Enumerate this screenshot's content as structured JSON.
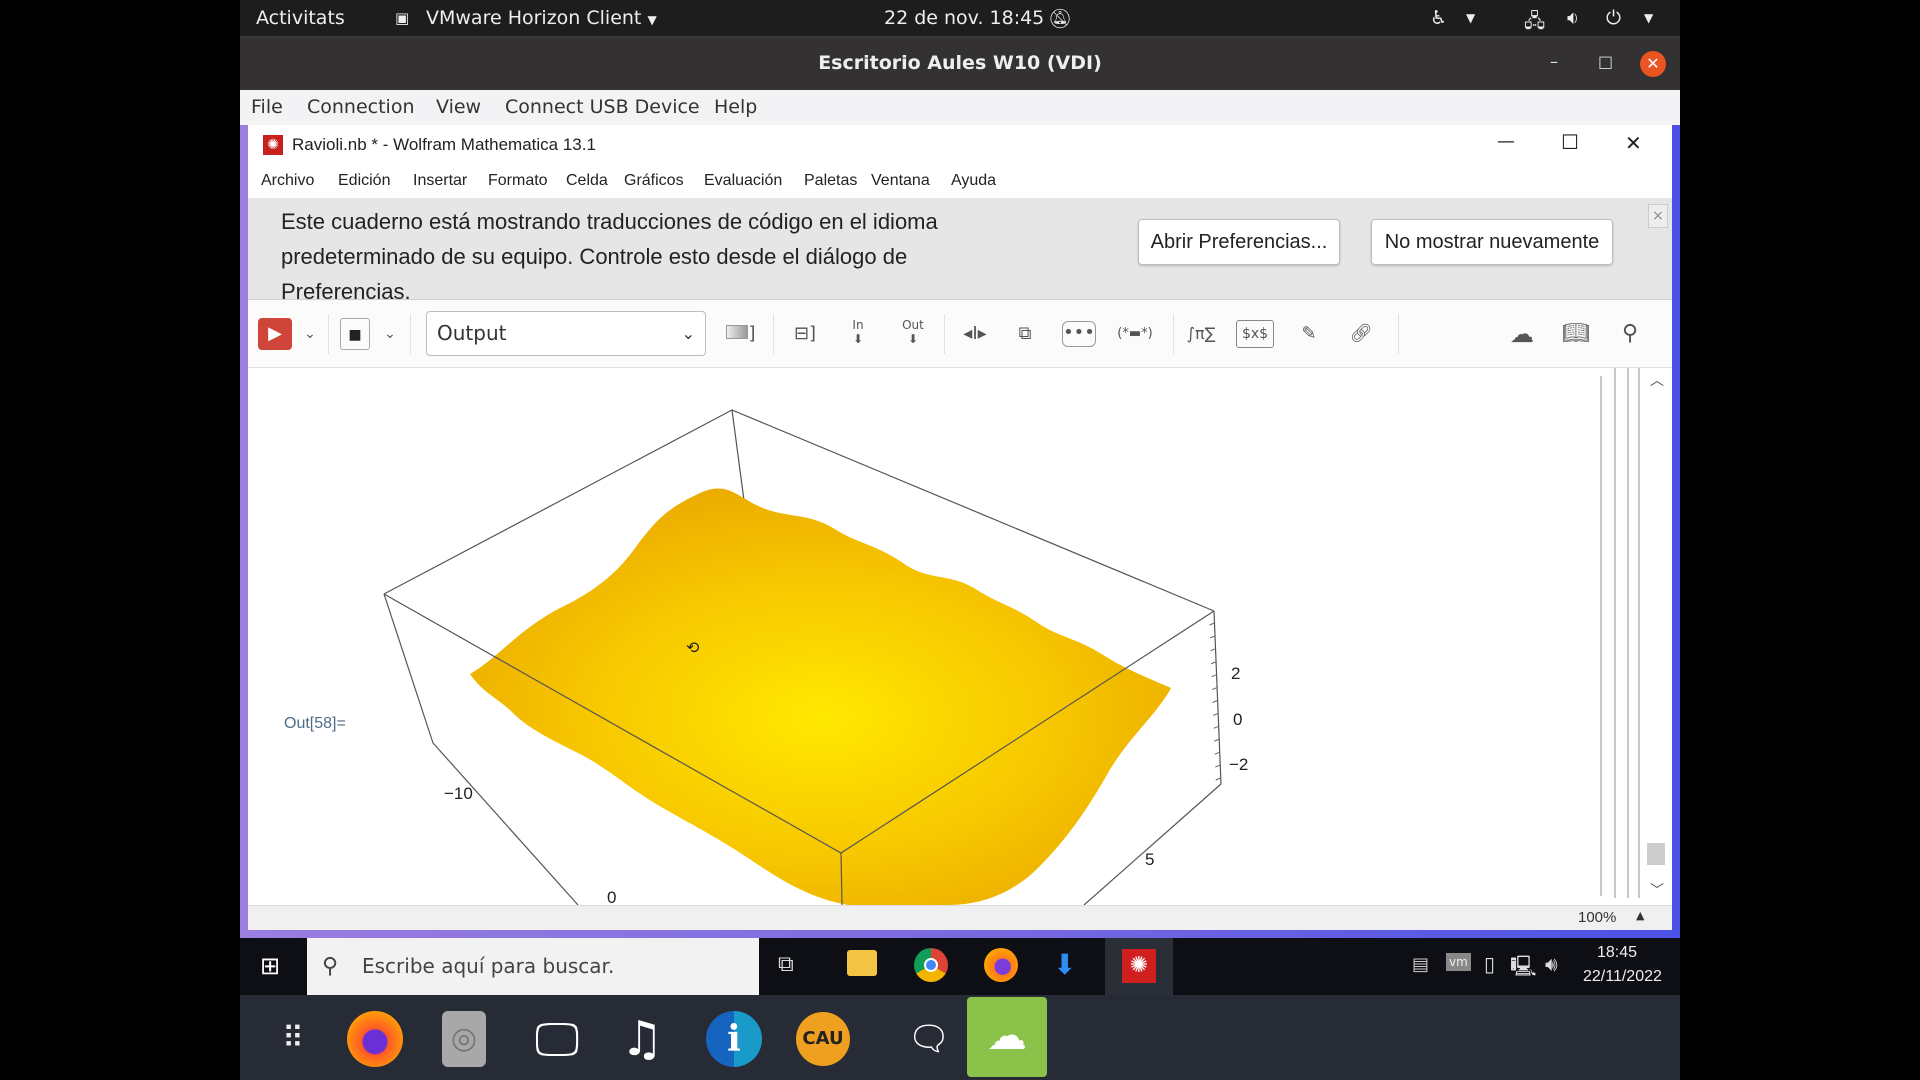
{
  "gnome_bar": {
    "activities": "Activitats",
    "app_menu": "VMware Horizon Client",
    "datetime": "22 de nov.  18:45",
    "icons": [
      "monitor-icon",
      "notifications-off-icon",
      "accessibility-icon",
      "network-icon",
      "volume-icon",
      "power-icon"
    ]
  },
  "vmware": {
    "title": "Escritorio Aules W10 (VDI)",
    "menu": [
      "File",
      "Connection",
      "View",
      "Connect USB Device",
      "Help"
    ],
    "controls": {
      "minimize": "–",
      "maximize": "□",
      "close": "✕"
    }
  },
  "mathematica": {
    "title": "Ravioli.nb * - Wolfram Mathematica 13.1",
    "controls": {
      "minimize": "—",
      "maximize": "☐",
      "close": "✕"
    },
    "menu": [
      "Archivo",
      "Edición",
      "Insertar",
      "Formato",
      "Celda",
      "Gráficos",
      "Evaluación",
      "Paletas",
      "Ventana",
      "Ayuda"
    ],
    "banner": {
      "message": "Este cuaderno está mostrando traducciones de código en el idioma predeterminado de su equipo. Controle esto desde el diálogo de Preferencias.",
      "open_prefs": "Abrir Preferencias...",
      "dont_show": "No mostrar nuevamente",
      "close": "×"
    },
    "toolbar": {
      "style_value": "Output",
      "icons": [
        "evaluate-icon",
        "chevron-down-icon",
        "abort-icon",
        "chevron-down-icon",
        "cell-bracket-icon",
        "group-cells-icon",
        "in-label-icon",
        "out-label-icon",
        "split-cell-icon",
        "merge-cell-icon",
        "more-icon",
        "comment-icon",
        "math-input-icon",
        "tex-icon",
        "drawing-icon",
        "link-icon",
        "cloud-upload-icon",
        "docs-icon",
        "search-icon"
      ],
      "in_label": "In",
      "out_label": "Out",
      "tex_label": "$x$",
      "pi_label": "∫π∑"
    },
    "cell": {
      "out_label": "Out[58]="
    },
    "status": {
      "zoom": "100%"
    }
  },
  "chart_data": {
    "type": "surface3d",
    "title": "",
    "description": "Ravioli-shaped 3D surface plot, yellow, with wavy edges",
    "z_ticks": [
      "2",
      "0",
      "−2"
    ],
    "x_ticks": [
      "−10",
      "0"
    ],
    "y_ticks": [
      "5"
    ],
    "zlim": [
      -3,
      3
    ],
    "color": "#f5c400"
  },
  "win_taskbar": {
    "search_placeholder": "Escribe aquí para buscar.",
    "apps": [
      "task-view-icon",
      "file-explorer-icon",
      "chrome-icon",
      "firefox-icon",
      "download-icon",
      "mathematica-icon"
    ],
    "tray": [
      "scanner-icon",
      "vmware-icon",
      "usb-icon",
      "network-icon",
      "volume-icon"
    ],
    "time": "18:45",
    "date": "22/11/2022"
  },
  "dock": {
    "items": [
      "app-grid-icon",
      "firefox-icon",
      "disc-icon",
      "screen-share-icon",
      "music-icon",
      "info-icon",
      "cau-icon",
      "notes-icon",
      "vmware-horizon-icon"
    ],
    "cau_label": "CAU"
  }
}
